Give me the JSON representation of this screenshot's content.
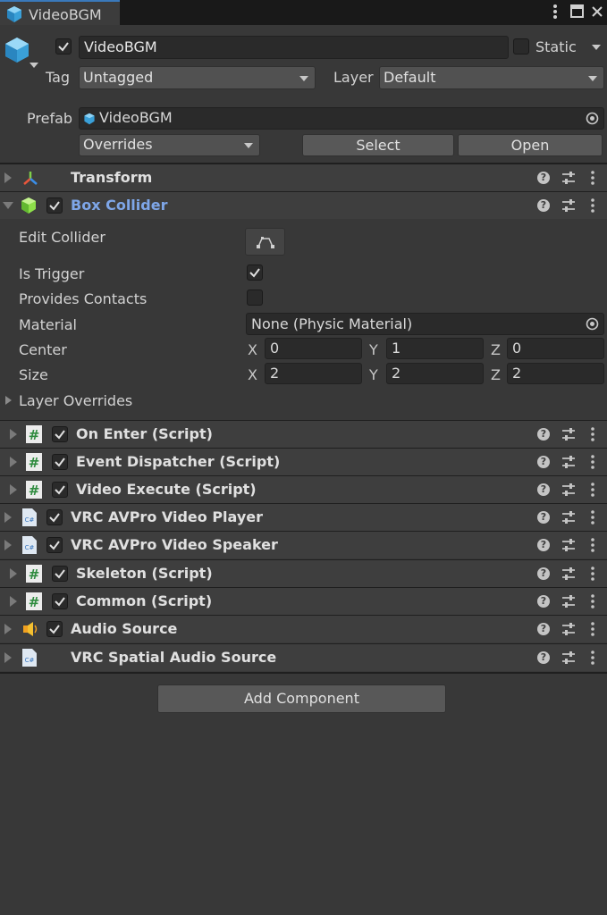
{
  "window": {
    "tab_title": "VideoBGM"
  },
  "header": {
    "name_value": "VideoBGM",
    "static_label": "Static",
    "tag_label": "Tag",
    "tag_value": "Untagged",
    "layer_label": "Layer",
    "layer_value": "Default",
    "prefab_label": "Prefab",
    "prefab_value": "VideoBGM",
    "overrides_label": "Overrides",
    "select_label": "Select",
    "open_label": "Open"
  },
  "components": {
    "transform": "Transform",
    "box_collider": "Box Collider",
    "on_enter": "On Enter (Script)",
    "event_dispatcher": "Event Dispatcher (Script)",
    "video_execute": "Video Execute (Script)",
    "vrc_avpro_player": "VRC AVPro Video Player",
    "vrc_avpro_speaker": "VRC AVPro Video Speaker",
    "skeleton": "Skeleton (Script)",
    "common": "Common (Script)",
    "audio_source": "Audio Source",
    "vrc_spatial_audio": "VRC Spatial Audio Source"
  },
  "box_collider": {
    "edit_collider_label": "Edit Collider",
    "is_trigger_label": "Is Trigger",
    "provides_contacts_label": "Provides Contacts",
    "material_label": "Material",
    "material_value": "None (Physic Material)",
    "center_label": "Center",
    "size_label": "Size",
    "axis_x": "X",
    "axis_y": "Y",
    "axis_z": "Z",
    "center": {
      "x": "0",
      "y": "1",
      "z": "0"
    },
    "size": {
      "x": "2",
      "y": "2",
      "z": "2"
    },
    "layer_overrides_label": "Layer Overrides"
  },
  "footer": {
    "add_component_label": "Add Component"
  },
  "colors": {
    "accent_blue": "#7ea6e8",
    "panel_bg": "#383838",
    "header_bg": "#3e3e3e"
  },
  "icons": [
    "cube-icon",
    "transform-icon",
    "box-collider-icon",
    "script-hash-icon",
    "csharp-file-icon",
    "audio-source-icon",
    "help-icon",
    "preset-icon",
    "kebab-menu-icon"
  ]
}
